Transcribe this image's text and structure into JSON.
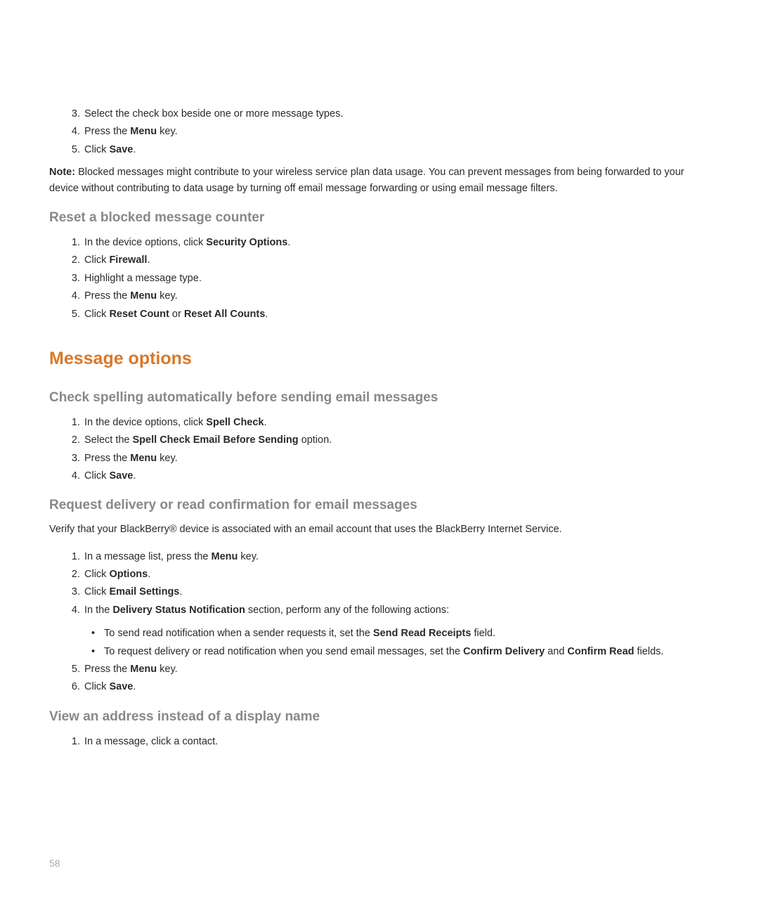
{
  "section1": {
    "steps": [
      {
        "num": "3.",
        "text": "Select the check box beside one or more message types."
      },
      {
        "num": "4.",
        "pre": "Press the ",
        "b1": "Menu",
        "post": " key."
      },
      {
        "num": "5.",
        "pre": "Click ",
        "b1": "Save",
        "post": "."
      }
    ],
    "note_label": "Note:",
    "note_body": "  Blocked messages might contribute to your wireless service plan data usage. You can prevent messages from being forwarded to your device without contributing to data usage by turning off email message forwarding or using email message filters."
  },
  "section2": {
    "heading": "Reset a blocked message counter",
    "steps": [
      {
        "num": "1.",
        "pre": "In the device options, click ",
        "b1": "Security Options",
        "post": "."
      },
      {
        "num": "2.",
        "pre": "Click ",
        "b1": "Firewall",
        "post": "."
      },
      {
        "num": "3.",
        "text": "Highlight a message type."
      },
      {
        "num": "4.",
        "pre": "Press the ",
        "b1": "Menu",
        "post": " key."
      },
      {
        "num": "5.",
        "pre": "Click ",
        "b1": "Reset Count",
        "mid": " or ",
        "b2": "Reset All Counts",
        "post": "."
      }
    ]
  },
  "section3": {
    "heading": "Message options"
  },
  "section4": {
    "heading": "Check spelling automatically before sending email messages",
    "steps": [
      {
        "num": "1.",
        "pre": "In the device options, click ",
        "b1": "Spell Check",
        "post": "."
      },
      {
        "num": "2.",
        "pre": "Select the ",
        "b1": "Spell Check Email Before Sending",
        "post": " option."
      },
      {
        "num": "3.",
        "pre": "Press the ",
        "b1": "Menu",
        "post": " key."
      },
      {
        "num": "4.",
        "pre": "Click ",
        "b1": "Save",
        "post": "."
      }
    ]
  },
  "section5": {
    "heading": "Request delivery or read confirmation for email messages",
    "intro": "Verify that your BlackBerry® device is associated with an email account that uses the BlackBerry Internet Service.",
    "steps": [
      {
        "num": "1.",
        "pre": "In a message list, press the ",
        "b1": "Menu",
        "post": " key."
      },
      {
        "num": "2.",
        "pre": "Click ",
        "b1": "Options",
        "post": "."
      },
      {
        "num": "3.",
        "pre": "Click ",
        "b1": "Email Settings",
        "post": "."
      },
      {
        "num": "4.",
        "pre": "In the ",
        "b1": "Delivery Status Notification",
        "post": " section, perform any of the following actions:"
      }
    ],
    "bullets": [
      {
        "pre": "To send read notification when a sender requests it, set the ",
        "b1": "Send Read Receipts",
        "post": " field."
      },
      {
        "pre": "To request delivery or read notification when you send email messages, set the ",
        "b1": "Confirm Delivery",
        "mid": " and ",
        "b2": "Confirm Read",
        "post": " fields."
      }
    ],
    "steps2": [
      {
        "num": "5.",
        "pre": "Press the ",
        "b1": "Menu",
        "post": " key."
      },
      {
        "num": "6.",
        "pre": "Click ",
        "b1": "Save",
        "post": "."
      }
    ]
  },
  "section6": {
    "heading": "View an address instead of a display name",
    "steps": [
      {
        "num": "1.",
        "text": "In a message, click a contact."
      }
    ]
  },
  "page_number": "58"
}
